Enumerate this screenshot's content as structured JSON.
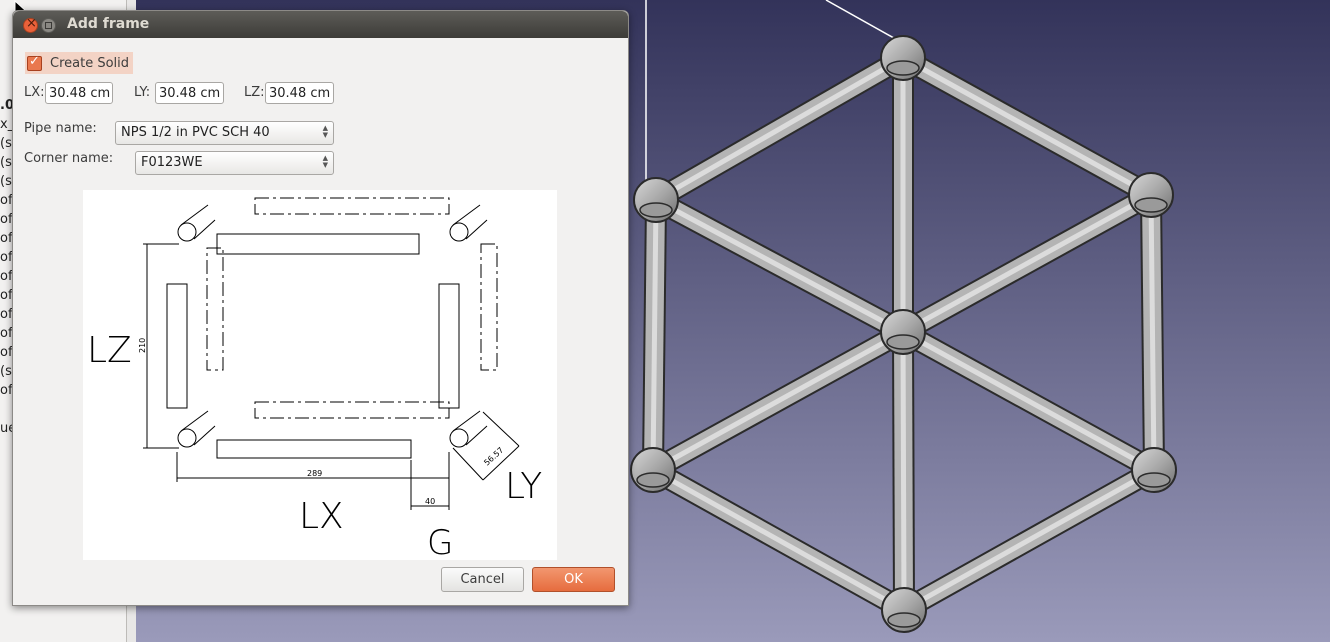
{
  "dialog": {
    "title": "Add frame",
    "create_solid_label": "Create Solid",
    "lx_label": "LX:",
    "lx_value": "30.48 cm",
    "ly_label": "LY:",
    "ly_value": "30.48 cm",
    "lz_label": "LZ:",
    "lz_value": "30.48 cm",
    "pipe_name_label": "Pipe name:",
    "pipe_name_value": "NPS 1/2 in PVC SCH 40",
    "corner_name_label": "Corner name:",
    "corner_name_value": "F0123WE",
    "cancel_label": "Cancel",
    "ok_label": "OK"
  },
  "diagram": {
    "lz": "LZ",
    "lx": "LX",
    "ly": "LY",
    "g": "G",
    "dim_210": "210",
    "dim_289": "289",
    "dim_40": "40",
    "dim_5657": "56.57"
  },
  "tree": {
    "fragments": [
      ".0",
      "x_",
      "(s(",
      "(s(",
      "(s(",
      "of",
      "of",
      "of",
      "of",
      "of",
      "of",
      "of",
      "of",
      "of",
      "(s",
      "of",
      "",
      "ue"
    ]
  },
  "colors": {
    "accent": "#e9784e",
    "viewport_top": "#33335a",
    "viewport_bottom": "#9a9aba",
    "pipe": "#b4b4b4"
  }
}
